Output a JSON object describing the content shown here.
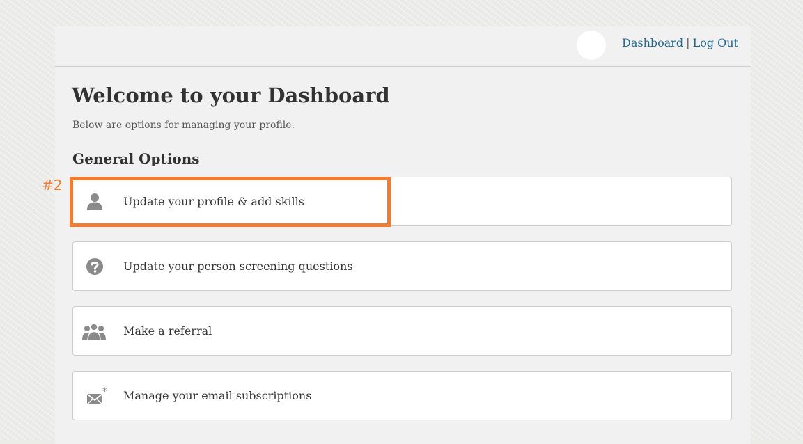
{
  "header": {
    "links": [
      {
        "label": "Dashboard"
      },
      {
        "label": "Log Out"
      }
    ],
    "separator": "|"
  },
  "main": {
    "title": "Welcome to your Dashboard",
    "subtitle": "Below are options for managing your profile.",
    "section_title": "General Options",
    "options": [
      {
        "label": "Update your profile & add skills",
        "icon": "user-icon"
      },
      {
        "label": "Update your person screening questions",
        "icon": "question-icon"
      },
      {
        "label": "Make a referral",
        "icon": "users-icon"
      },
      {
        "label": "Manage your email subscriptions",
        "icon": "envelope-icon"
      }
    ]
  },
  "annotation": {
    "marker": "#2",
    "color": "#ee7c33"
  },
  "colors": {
    "link": "#1d6a93",
    "panel_bg": "#f1f1f1",
    "icon": "#8a8a8a"
  }
}
